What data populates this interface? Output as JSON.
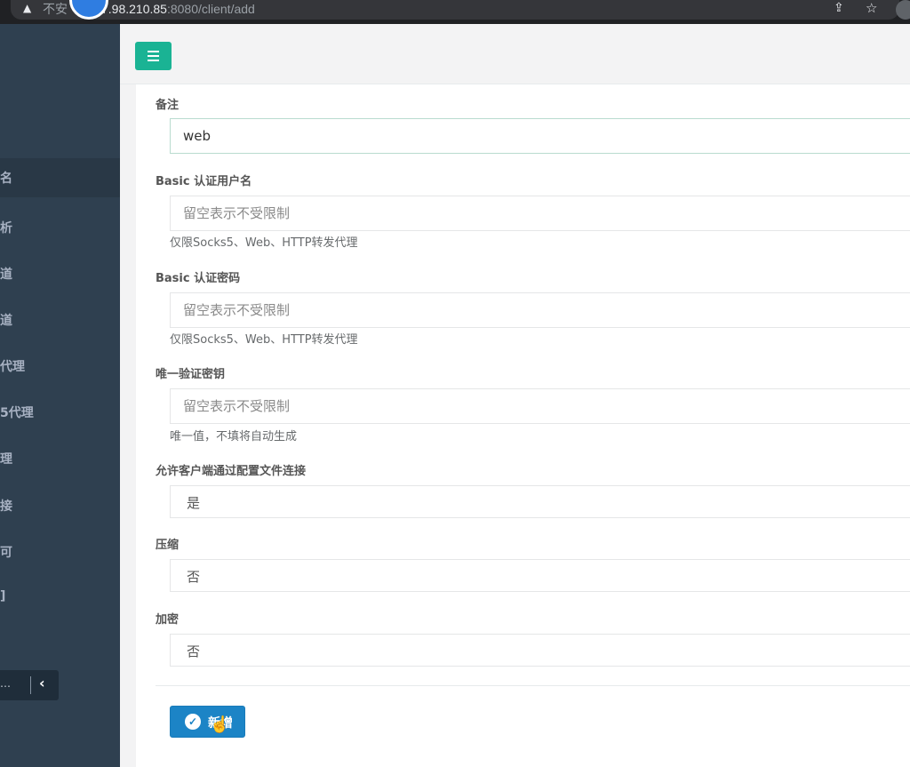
{
  "browser": {
    "url_prefix": "不安",
    "url_host": "7.98.210.85",
    "url_rest": ":8080/client/add",
    "icons": {
      "warning": "warning-icon",
      "share": "share-icon",
      "star": "star-icon"
    }
  },
  "sidebar": {
    "items": [
      {
        "label": "名",
        "active": true
      },
      {
        "label": "析",
        "active": false
      },
      {
        "label": "道",
        "active": false
      },
      {
        "label": "道",
        "active": false
      },
      {
        "label": "代理",
        "active": false
      },
      {
        "label": "5代理",
        "active": false
      },
      {
        "label": "理",
        "active": false
      },
      {
        "label": "接",
        "active": false
      },
      {
        "label": "可",
        "active": false
      },
      {
        "label": "]",
        "active": false
      }
    ],
    "collapse_label": "…"
  },
  "form": {
    "remark": {
      "label": "备注",
      "value": "web"
    },
    "basic_user": {
      "label": "Basic 认证用户名",
      "placeholder": "留空表示不受限制",
      "help": "仅限Socks5、Web、HTTP转发代理"
    },
    "basic_pass": {
      "label": "Basic 认证密码",
      "placeholder": "留空表示不受限制",
      "help": "仅限Socks5、Web、HTTP转发代理"
    },
    "vkey": {
      "label": "唯一验证密钥",
      "placeholder": "留空表示不受限制",
      "help": "唯一值，不填将自动生成"
    },
    "config_conn": {
      "label": "允许客户端通过配置文件连接",
      "value": "是"
    },
    "compress": {
      "label": "压缩",
      "value": "否"
    },
    "crypt": {
      "label": "加密",
      "value": "否"
    },
    "submit_label": "新增"
  },
  "colors": {
    "sidebar": "#2f4050",
    "accent": "#1ab394",
    "primary": "#1c84c6"
  }
}
